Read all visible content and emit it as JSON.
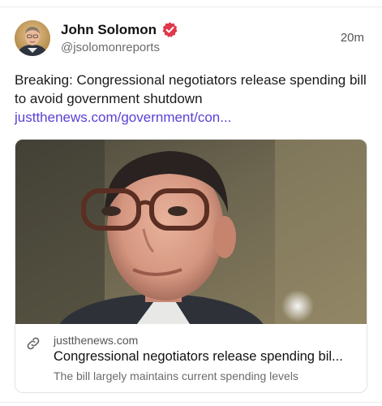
{
  "post": {
    "author_name": "John Solomon",
    "handle": "@jsolomonreports",
    "timestamp": "20m",
    "text": "Breaking: Congressional negotiators release spending bill to avoid government shutdown",
    "link_text": "justthenews.com/government/con...",
    "verified_badge_icon": "verified-badge-icon",
    "accent_color": "#5b3fd6",
    "badge_color": "#e0384b"
  },
  "card": {
    "domain": "justthenews.com",
    "title": "Congressional negotiators release spending bil...",
    "description": "The bill largely maintains current spending levels",
    "link_icon": "link-icon"
  }
}
